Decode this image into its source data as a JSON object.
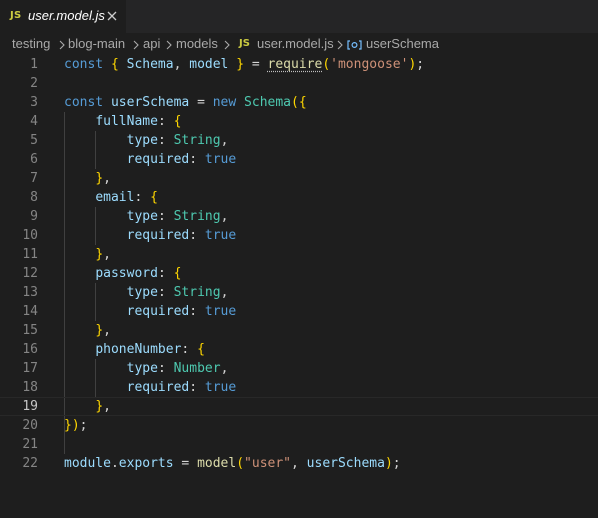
{
  "tab": {
    "badge": "JS",
    "title": "user.model.js",
    "close_icon": "close-icon"
  },
  "breadcrumb": {
    "items": [
      "testing",
      "blog-main",
      "api",
      "models"
    ],
    "file_badge": "JS",
    "file": "user.model.js",
    "symbol_icon": "symbol-variable-icon",
    "symbol": "userSchema"
  },
  "editor": {
    "active_line": 19,
    "line_numbers": [
      "1",
      "2",
      "3",
      "4",
      "5",
      "6",
      "7",
      "8",
      "9",
      "10",
      "11",
      "12",
      "13",
      "14",
      "15",
      "16",
      "17",
      "18",
      "19",
      "20",
      "21",
      "22"
    ],
    "lines": [
      "const { Schema, model } = require('mongoose');",
      "",
      "const userSchema = new Schema({",
      "    fullName: {",
      "        type: String,",
      "        required: true",
      "    },",
      "    email: {",
      "        type: String,",
      "        required: true",
      "    },",
      "    password: {",
      "        type: String,",
      "        required: true",
      "    },",
      "    phoneNumber: {",
      "        type: Number,",
      "        required: true",
      "    },",
      "});",
      "",
      "module.exports = model(\"user\", userSchema);"
    ]
  },
  "colors": {
    "background": "#1e1e1e",
    "tabbar": "#252526",
    "keyword": "#569cd6",
    "variable": "#9cdcfe",
    "function": "#dcdcaa",
    "string": "#ce9178",
    "type": "#4ec9b0",
    "js_badge": "#cbcb41",
    "bracket": "#ffd700"
  }
}
